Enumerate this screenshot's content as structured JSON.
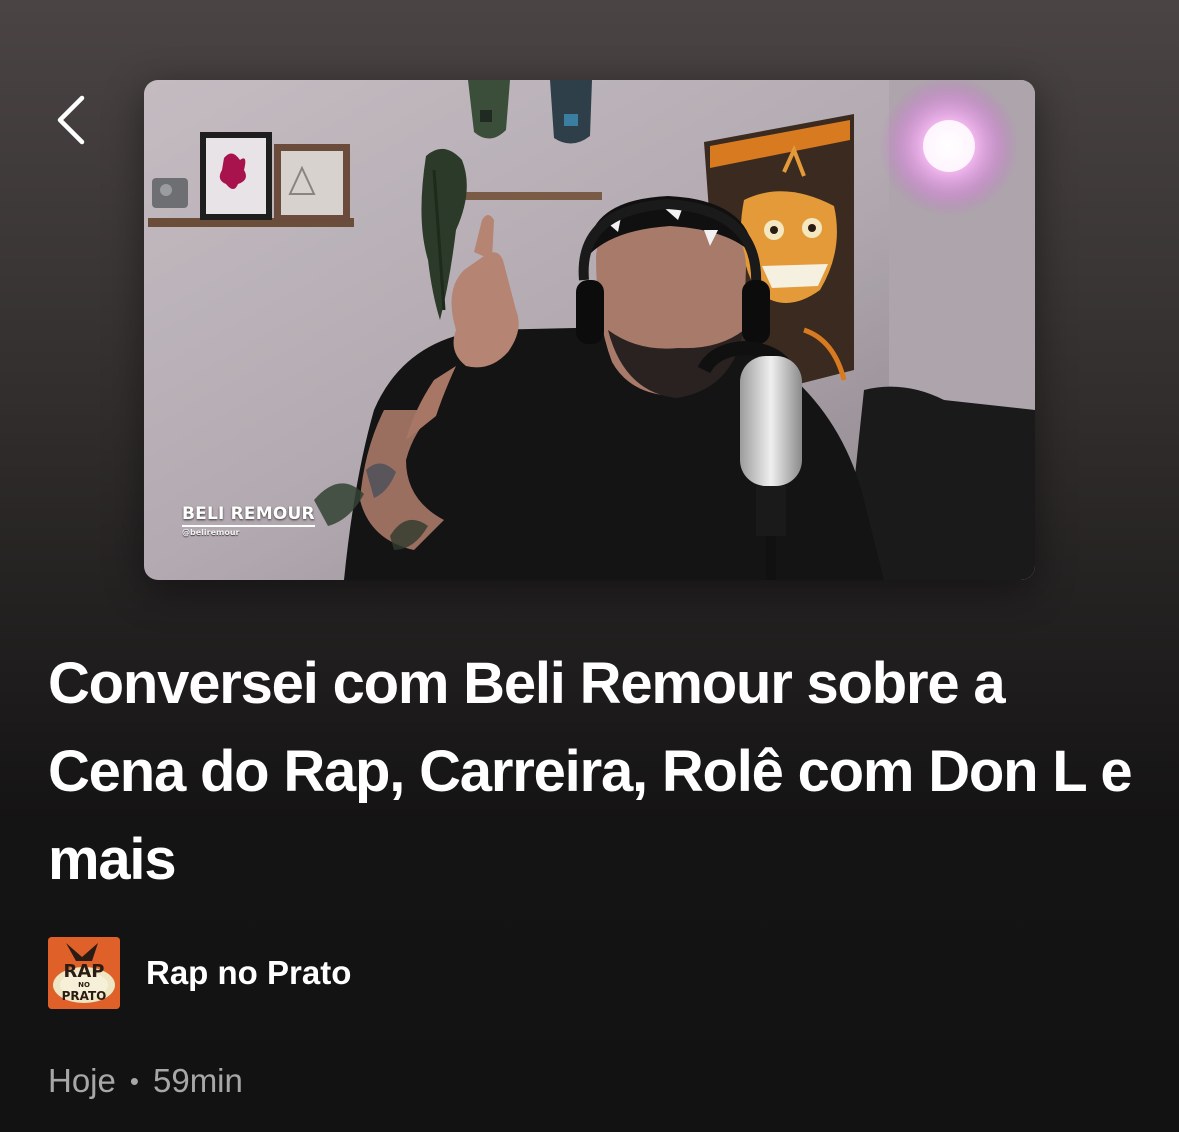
{
  "header": {
    "back_icon": "chevron-left-icon"
  },
  "cover": {
    "overlay_name": "BELI REMOUR",
    "overlay_handle": "@beliremour"
  },
  "episode": {
    "title": "Conversei com Beli Remour sobre a Cena do Rap, Carreira, Rolê com Don L e mais",
    "date": "Hoje",
    "separator": "•",
    "duration": "59min"
  },
  "show": {
    "name": "Rap no Prato",
    "thumb_text_1": "RAP",
    "thumb_text_2": "NO",
    "thumb_text_3": "PRATO"
  },
  "colors": {
    "background_top": "#4a4444",
    "background_bottom": "#121212",
    "text_primary": "#ffffff",
    "text_secondary": "#a7a7a7",
    "show_thumb_bg": "#e0602a"
  }
}
